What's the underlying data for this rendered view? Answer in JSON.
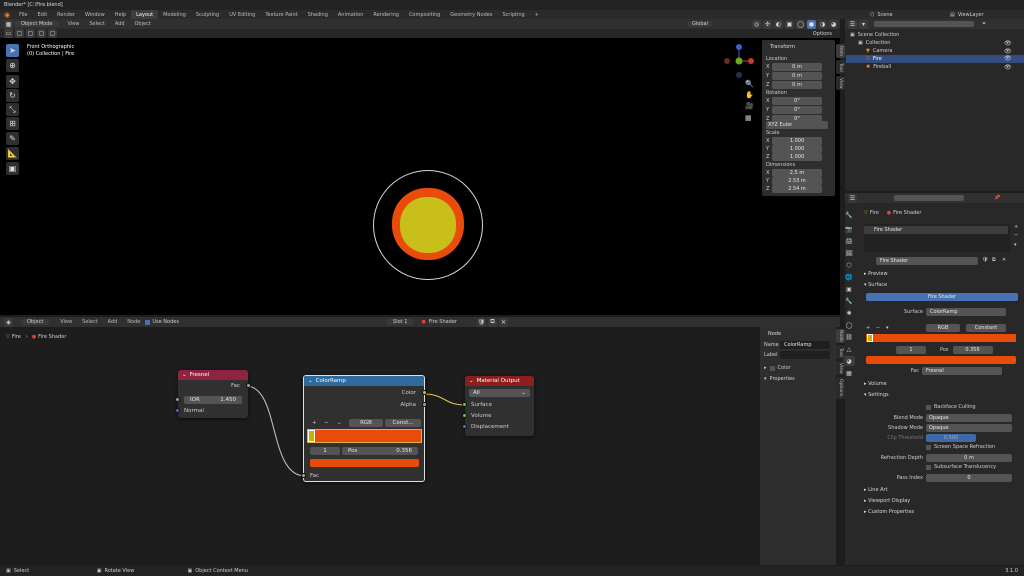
{
  "window": {
    "title": "Blender* [C:\\Fire.blend]"
  },
  "menus": [
    "File",
    "Edit",
    "Render",
    "Window",
    "Help"
  ],
  "workspaces": [
    "Layout",
    "Modeling",
    "Sculpting",
    "UV Editing",
    "Texture Paint",
    "Shading",
    "Animation",
    "Rendering",
    "Compositing",
    "Geometry Nodes",
    "Scripting"
  ],
  "scene": {
    "name": "Scene",
    "view_layer": "ViewLayer"
  },
  "viewport": {
    "header": {
      "mode": "Object Mode",
      "menu": [
        "View",
        "Select",
        "Add",
        "Object"
      ],
      "transform": "Global",
      "options": "Options"
    },
    "overlay_title": "Front Orthographic",
    "overlay_sub": "(0) Collection | Fire"
  },
  "n_panel": {
    "title": "Transform",
    "location_label": "Location",
    "location": [
      {
        "axis": "X",
        "value": "0 m"
      },
      {
        "axis": "Y",
        "value": "0 m"
      },
      {
        "axis": "Z",
        "value": "0 m"
      }
    ],
    "rotation_label": "Rotation",
    "rotation": [
      {
        "axis": "X",
        "value": "0°"
      },
      {
        "axis": "Y",
        "value": "0°"
      },
      {
        "axis": "Z",
        "value": "0°"
      }
    ],
    "rot_mode": "XYZ Euler",
    "scale_label": "Scale",
    "scale": [
      {
        "axis": "X",
        "value": "1.000"
      },
      {
        "axis": "Y",
        "value": "1.000"
      },
      {
        "axis": "Z",
        "value": "1.000"
      }
    ],
    "dims_label": "Dimensions",
    "dims": [
      {
        "axis": "X",
        "value": "2.5 m"
      },
      {
        "axis": "Y",
        "value": "2.53 m"
      },
      {
        "axis": "Z",
        "value": "2.54 m"
      }
    ],
    "tabs": [
      "Item",
      "Tool",
      "View"
    ]
  },
  "outliner": {
    "search_placeholder": "",
    "items": [
      {
        "label": "Scene Collection"
      },
      {
        "label": "Collection"
      },
      {
        "label": "Camera"
      },
      {
        "label": "Fire"
      },
      {
        "label": "Fireball"
      }
    ]
  },
  "node_editor": {
    "header": {
      "type": "Object",
      "menu": [
        "View",
        "Select",
        "Add",
        "Node"
      ],
      "use_nodes": "Use Nodes",
      "slot": "Slot 1",
      "material": "Fire Shader"
    },
    "breadcrumb": [
      "Fire",
      "Fire Shader"
    ],
    "nodes": {
      "fresnel": {
        "title": "Fresnel",
        "out": "Fac",
        "ior_label": "IOR",
        "ior": "1.450",
        "normal": "Normal"
      },
      "colorramp": {
        "title": "ColorRamp",
        "out_color": "Color",
        "out_alpha": "Alpha",
        "mode": "RGB",
        "interp": "Const...",
        "stop": "1",
        "pos_label": "Pos",
        "pos": "0.356",
        "in": "Fac"
      },
      "output": {
        "title": "Material Output",
        "target": "All",
        "surface": "Surface",
        "volume": "Volume",
        "displacement": "Displacement"
      }
    },
    "side": {
      "title": "Node",
      "name_label": "Name",
      "name": "ColorRamp",
      "label_label": "Label",
      "label": "",
      "color": "Color",
      "props": "Properties",
      "tabs": [
        "Node",
        "Tool",
        "View",
        "Options"
      ]
    }
  },
  "props": {
    "header_obj": "Fire",
    "header_mat": "Fire Shader",
    "slot": "Fire Shader",
    "mat_name": "Fire Shader",
    "sections": {
      "preview": "Preview",
      "surface": "Surface",
      "volume": "Volume",
      "settings": "Settings",
      "lineart": "Line Art",
      "viewport": "Viewport Display",
      "custom": "Custom Properties"
    },
    "surface_btn": "Fire Shader",
    "surface_label": "Surface",
    "surface_val": "ColorRamp",
    "ramp_mode": "RGB",
    "ramp_interp": "Constant",
    "ramp_stop": "1",
    "ramp_pos_label": "Pos",
    "ramp_pos": "0.356",
    "fac_label": "Fac",
    "fac_val": "Fresnel",
    "settings": {
      "backface": "Backface Culling",
      "blend_label": "Blend Mode",
      "blend": "Opaque",
      "shadow_label": "Shadow Mode",
      "shadow": "Opaque",
      "clip_label": "Clip Threshold",
      "clip": "0.500",
      "ssr": "Screen Space Refraction",
      "refr_label": "Refraction Depth",
      "refr": "0 m",
      "sss": "Subsurface Translucency",
      "pass_label": "Pass Index",
      "pass": "0"
    }
  },
  "status": {
    "left": "Select",
    "mid": "Rotate View",
    "mid2": "Object Context Menu",
    "version": "3.1.0"
  },
  "colors": {
    "accent": "#4772b3",
    "ramp_orange": "#e84b0a",
    "ramp_yellow": "#c8b400",
    "fire_red": "#e84b0a",
    "fire_yellow": "#c9bf1a",
    "fresnel_head": "#8e2440",
    "input_blue": "#2c6aa0",
    "output_red": "#8e1e1e"
  }
}
